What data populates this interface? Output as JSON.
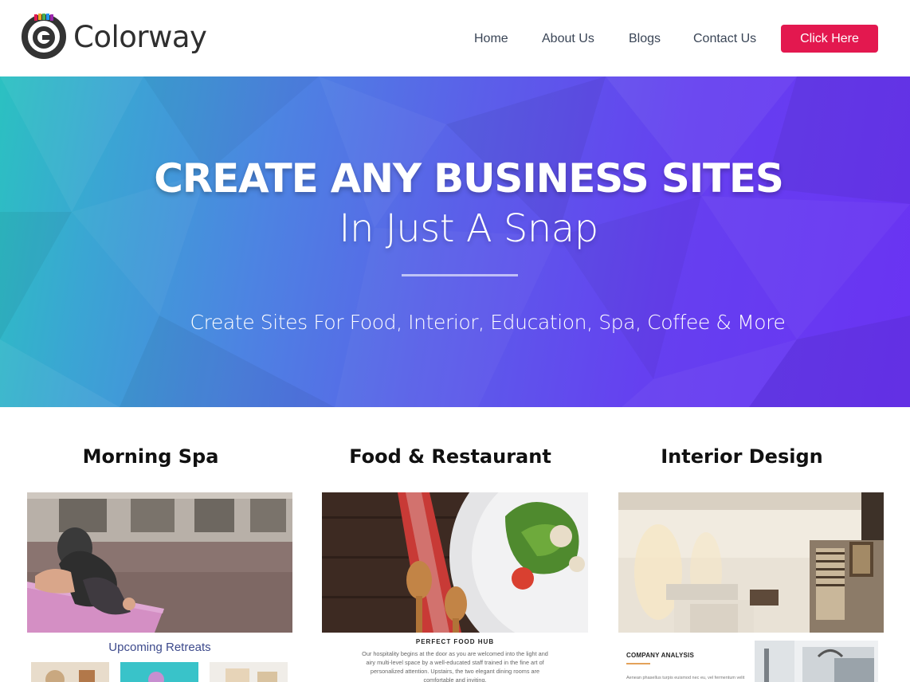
{
  "brand": {
    "name": "Colorway",
    "accent": "#e3184f"
  },
  "nav": {
    "items": [
      {
        "label": "Home"
      },
      {
        "label": "About Us"
      },
      {
        "label": "Blogs"
      },
      {
        "label": "Contact Us"
      }
    ],
    "cta_label": "Click Here"
  },
  "hero": {
    "title": "CREATE ANY BUSINESS SITES",
    "subtitle": "In Just A Snap",
    "tagline": "Create Sites For Food, Interior, Education, Spa, Coffee & More",
    "gradient_start": "#2bc1c1",
    "gradient_end": "#6a33f3"
  },
  "cards": [
    {
      "title": "Morning Spa",
      "preview_heading": "Upcoming Retreats"
    },
    {
      "title": "Food & Restaurant",
      "preview_heading": "PERFECT FOOD HUB",
      "preview_text": "Our hospitality begins at the door as you are welcomed into the light and airy multi-level space by a well-educated staff trained in the fine art of personalized attention. Upstairs, the two elegant dining rooms are comfortable and inviting."
    },
    {
      "title": "Interior Design",
      "preview_heading": "COMPANY ANALYSIS",
      "preview_text": "Aenean phasellus turpis euismod nec eu, vel fermentum velit"
    }
  ]
}
